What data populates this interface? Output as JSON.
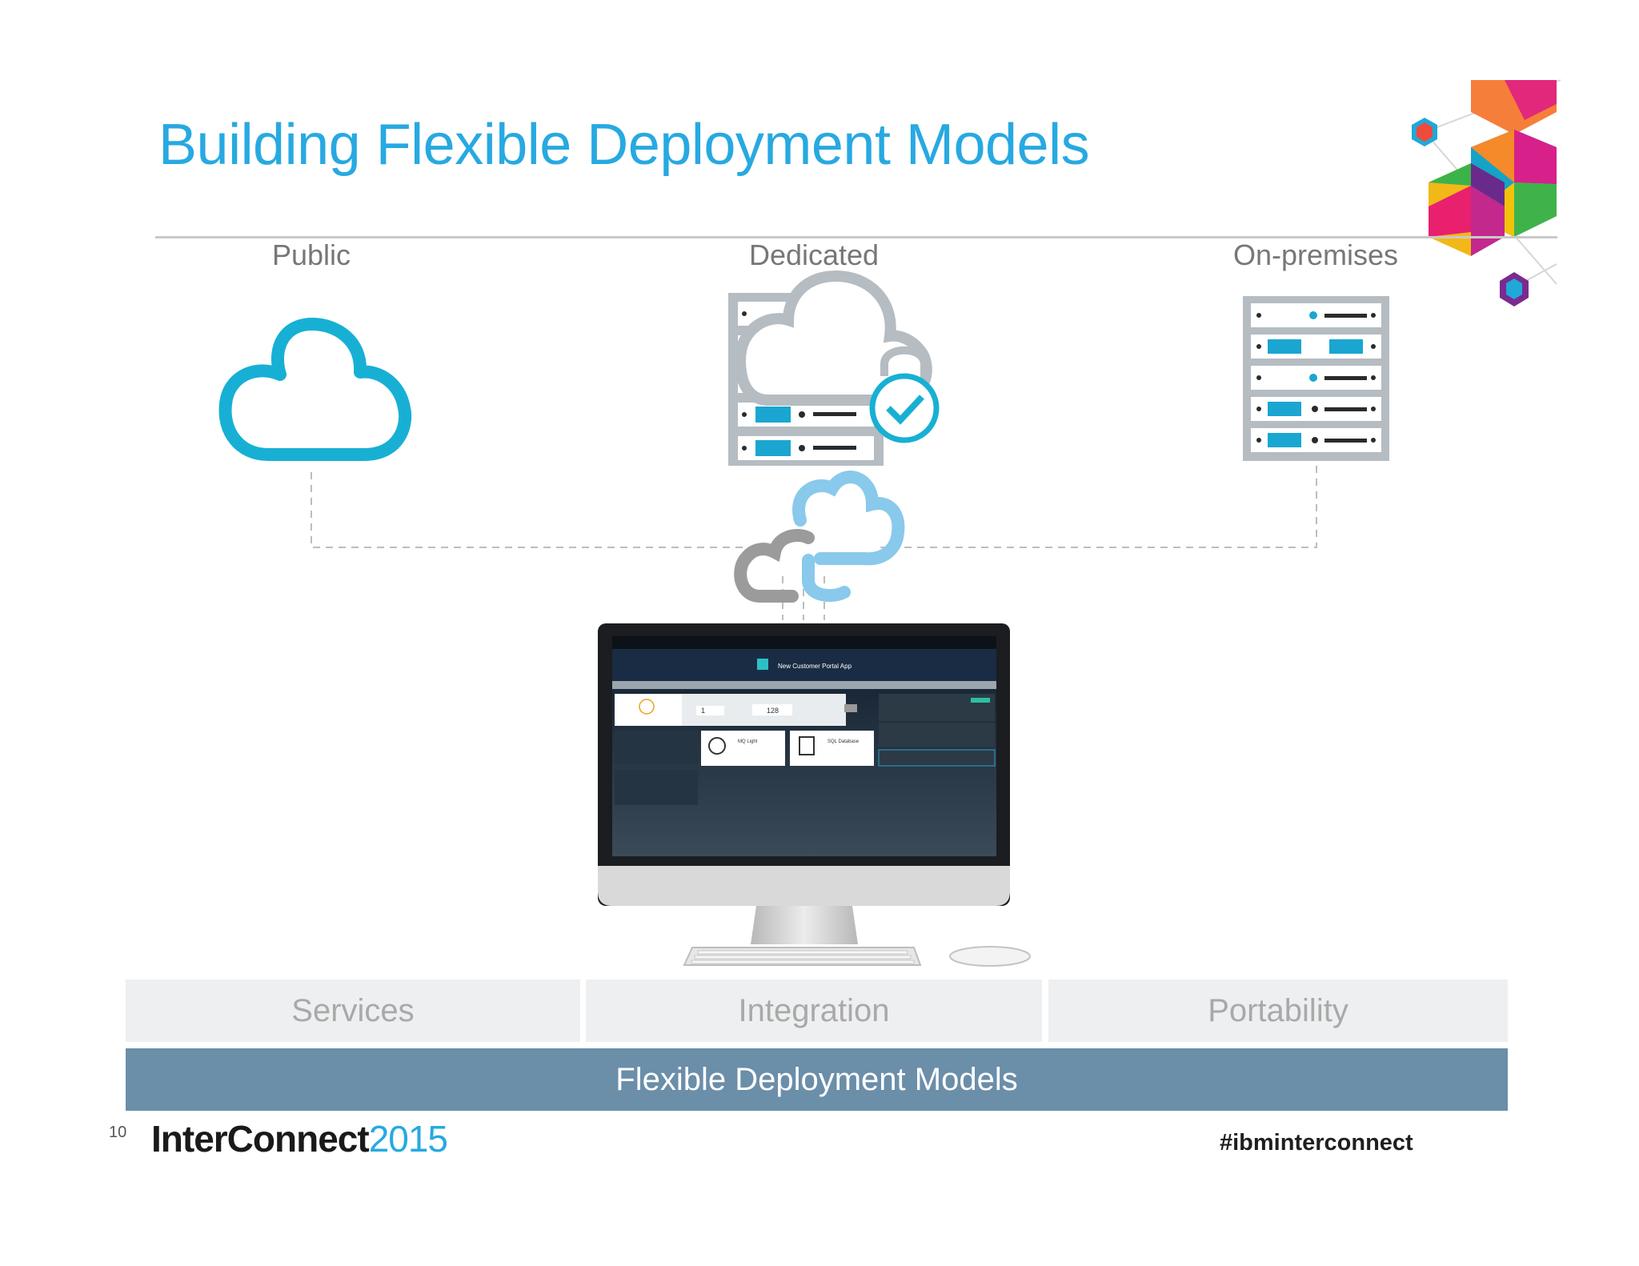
{
  "slide": {
    "title": "Building Flexible Deployment Models",
    "columns": {
      "public": "Public",
      "dedicated": "Dedicated",
      "on_premises": "On-premises"
    },
    "pillars": [
      "Services",
      "Integration",
      "Portability"
    ],
    "foundation": "Flexible Deployment Models",
    "page_number": "10",
    "brand_name": "InterConnect",
    "brand_year": "2015",
    "hashtag": "#ibminterconnect"
  },
  "screen": {
    "app_title": "New Customer Portal App",
    "instances": "1",
    "memory": "128",
    "cards": [
      "MQ Light",
      "SQL Database"
    ]
  },
  "colors": {
    "accent_blue": "#27a9e1",
    "cloud_blue": "#17b0d4",
    "server_gray": "#b5bcc2",
    "foundation_bar": "#6b8ea9",
    "pillar_bg": "#eeeff0"
  },
  "icons": [
    "public-cloud-icon",
    "dedicated-server-cloud-icon",
    "lock-icon",
    "check-icon",
    "on-premises-server-icon",
    "hybrid-cloud-connector-icon",
    "monitor-icon",
    "keyboard-icon",
    "mouse-icon",
    "hexagon-logo-icon"
  ]
}
